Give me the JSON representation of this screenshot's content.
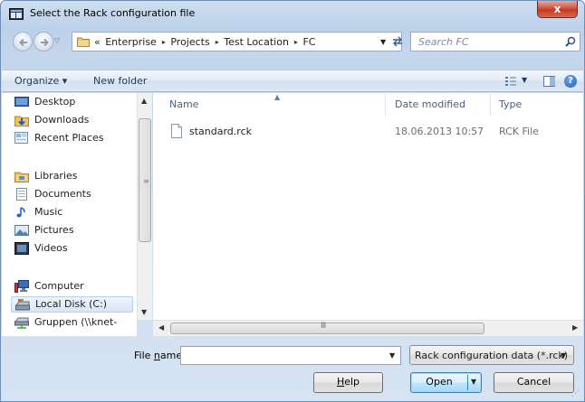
{
  "window": {
    "title": "Select the Rack configuration file",
    "close_label": "x"
  },
  "address": {
    "overflow_marker": "«",
    "crumbs": [
      "Enterprise",
      "Projects",
      "Test Location",
      "FC"
    ],
    "separator": "▸"
  },
  "search": {
    "placeholder": "Search FC"
  },
  "toolbar": {
    "organize_label": "Organize ▾",
    "new_folder_label": "New folder",
    "help_label": "?"
  },
  "navigation": {
    "items": [
      {
        "label": "Desktop",
        "icon": "desktop-icon"
      },
      {
        "label": "Downloads",
        "icon": "downloads-folder-icon"
      },
      {
        "label": "Recent Places",
        "icon": "recent-places-icon"
      },
      {
        "label": "Libraries",
        "icon": "libraries-icon"
      },
      {
        "label": "Documents",
        "icon": "documents-icon"
      },
      {
        "label": "Music",
        "icon": "music-icon"
      },
      {
        "label": "Pictures",
        "icon": "pictures-icon"
      },
      {
        "label": "Videos",
        "icon": "videos-icon"
      },
      {
        "label": "Computer",
        "icon": "computer-icon"
      },
      {
        "label": "Local Disk (C:)",
        "icon": "local-disk-icon",
        "selected": true
      },
      {
        "label": "Gruppen (\\\\knet-",
        "icon": "network-drive-icon"
      }
    ]
  },
  "file_list": {
    "columns": [
      "Name",
      "Date modified",
      "Type"
    ],
    "rows": [
      {
        "name": "standard.rck",
        "date_modified": "18.06.2013 10:57",
        "type": "RCK File",
        "icon": "file-icon"
      }
    ]
  },
  "footer": {
    "file_name_label_prefix": "File ",
    "file_name_label_accel": "n",
    "file_name_label_suffix": "ame:",
    "file_name_value": "",
    "filter_value": "Rack configuration data (*.rck)",
    "help_button_accel": "H",
    "help_button_rest": "elp",
    "open_button": "Open",
    "cancel_button": "Cancel"
  },
  "colors": {
    "frame": "#c4d6ec",
    "close_button": "#c23a22",
    "selection": "#d9e6f7"
  }
}
